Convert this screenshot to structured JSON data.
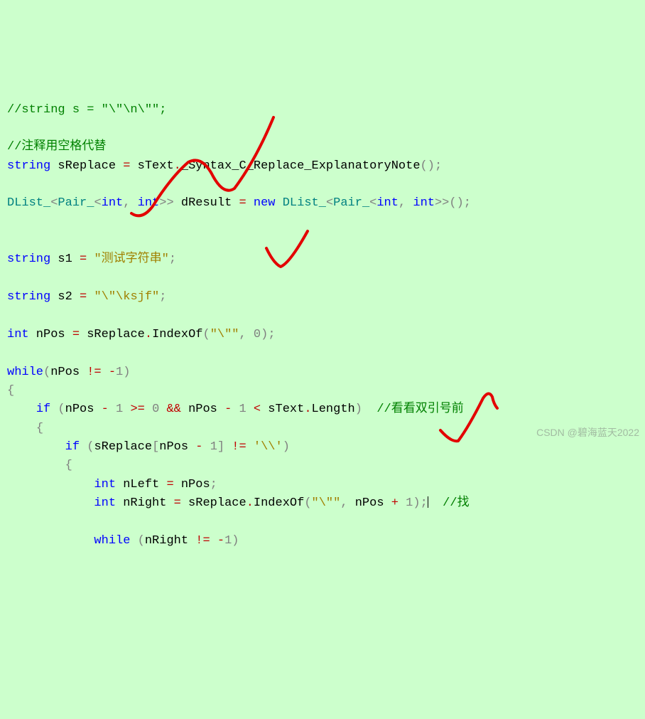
{
  "code": {
    "l1_comment": "//string s = \"\\\"\\n\\\"\";",
    "l2_comment": "//注释用空格代替",
    "l3_kw": "string",
    "l3_var": " sReplace ",
    "l3_op": "=",
    "l3_expr": " sText",
    "l3_dot": ".",
    "l3_method": "_Syntax_C_Replace_ExplanatoryNote",
    "l3_paren": "()",
    "l3_semi": ";",
    "l4_type1": "DList_",
    "l4_angle_l": "<",
    "l4_type2": "Pair_",
    "l4_angle_l2": "<",
    "l4_int": "int",
    "l4_comma": ", ",
    "l4_int2": "int",
    "l4_angle_r2": ">>",
    "l4_var": " dResult ",
    "l4_op": "=",
    "l4_sp": " ",
    "l4_new": "new",
    "l4_type3": " DList_",
    "l4_angle_l3": "<",
    "l4_type4": "Pair_",
    "l4_angle_l4": "<",
    "l4_int3": "int",
    "l4_comma2": ", ",
    "l4_int4": "int",
    "l4_angle_r4": ">>",
    "l4_paren": "()",
    "l4_semi": ";",
    "l5_kw": "string",
    "l5_var": " s1 ",
    "l5_op": "=",
    "l5_sp": " ",
    "l5_str": "\"测试字符串\"",
    "l5_semi": ";",
    "l6_kw": "string",
    "l6_var": " s2 ",
    "l6_op": "=",
    "l6_sp": " ",
    "l6_str": "\"\\\"\\ksjf\"",
    "l6_semi": ";",
    "l7_kw": "int",
    "l7_var": " nPos ",
    "l7_op": "=",
    "l7_expr": " sReplace",
    "l7_dot": ".",
    "l7_method": "IndexOf",
    "l7_paren_l": "(",
    "l7_str": "\"\\\"\"",
    "l7_comma": ", ",
    "l7_num": "0",
    "l7_paren_r": ")",
    "l7_semi": ";",
    "l8_kw": "while",
    "l8_paren_l": "(",
    "l8_expr1": "nPos ",
    "l8_neq": "!=",
    "l8_sp": " ",
    "l8_neg": "-",
    "l8_num": "1",
    "l8_paren_r": ")",
    "l9_brace": "{",
    "l10_indent": "    ",
    "l10_kw": "if",
    "l10_sp": " ",
    "l10_paren_l": "(",
    "l10_expr1": "nPos ",
    "l10_minus": "-",
    "l10_sp2": " ",
    "l10_num1": "1",
    "l10_sp3": " ",
    "l10_ge": ">=",
    "l10_sp4": " ",
    "l10_num2": "0",
    "l10_sp5": " ",
    "l10_and": "&&",
    "l10_sp6": " nPos ",
    "l10_minus2": "-",
    "l10_sp7": " ",
    "l10_num3": "1",
    "l10_sp8": " ",
    "l10_lt": "<",
    "l10_expr2": " sText",
    "l10_dot": ".",
    "l10_prop": "Length",
    "l10_paren_r": ")",
    "l10_sp9": "  ",
    "l10_comment": "//看看双引号前",
    "l11_indent": "    ",
    "l11_brace": "{",
    "l12_indent": "        ",
    "l12_kw": "if",
    "l12_sp": " ",
    "l12_paren_l": "(",
    "l12_expr1": "sReplace",
    "l12_bracket_l": "[",
    "l12_expr2": "nPos ",
    "l12_minus": "-",
    "l12_sp2": " ",
    "l12_num": "1",
    "l12_bracket_r": "]",
    "l12_sp3": " ",
    "l12_neq": "!=",
    "l12_sp4": " ",
    "l12_char": "'\\\\'",
    "l12_paren_r": ")",
    "l13_indent": "        ",
    "l13_brace": "{",
    "l14_indent": "            ",
    "l14_kw": "int",
    "l14_var": " nLeft ",
    "l14_op": "=",
    "l14_expr": " nPos",
    "l14_semi": ";",
    "l15_indent": "            ",
    "l15_kw": "int",
    "l15_var": " nRight ",
    "l15_op": "=",
    "l15_expr": " sReplace",
    "l15_dot": ".",
    "l15_method": "IndexOf",
    "l15_paren_l": "(",
    "l15_str": "\"\\\"\"",
    "l15_comma": ",",
    "l15_sp": " ",
    "l15_expr2": "nPos ",
    "l15_plus": "+",
    "l15_sp2": " ",
    "l15_num": "1",
    "l15_paren_r": ")",
    "l15_semi": ";",
    "l15_sp3": "  ",
    "l15_comment": "//找",
    "l16_indent": "            ",
    "l16_kw": "while",
    "l16_sp": " ",
    "l16_paren_l": "(",
    "l16_expr": "nRight ",
    "l16_neq": "!=",
    "l16_sp2": " ",
    "l16_neg": "-",
    "l16_num": "1",
    "l16_paren_r": ")"
  },
  "watermark": "CSDN @碧海蓝天2022"
}
